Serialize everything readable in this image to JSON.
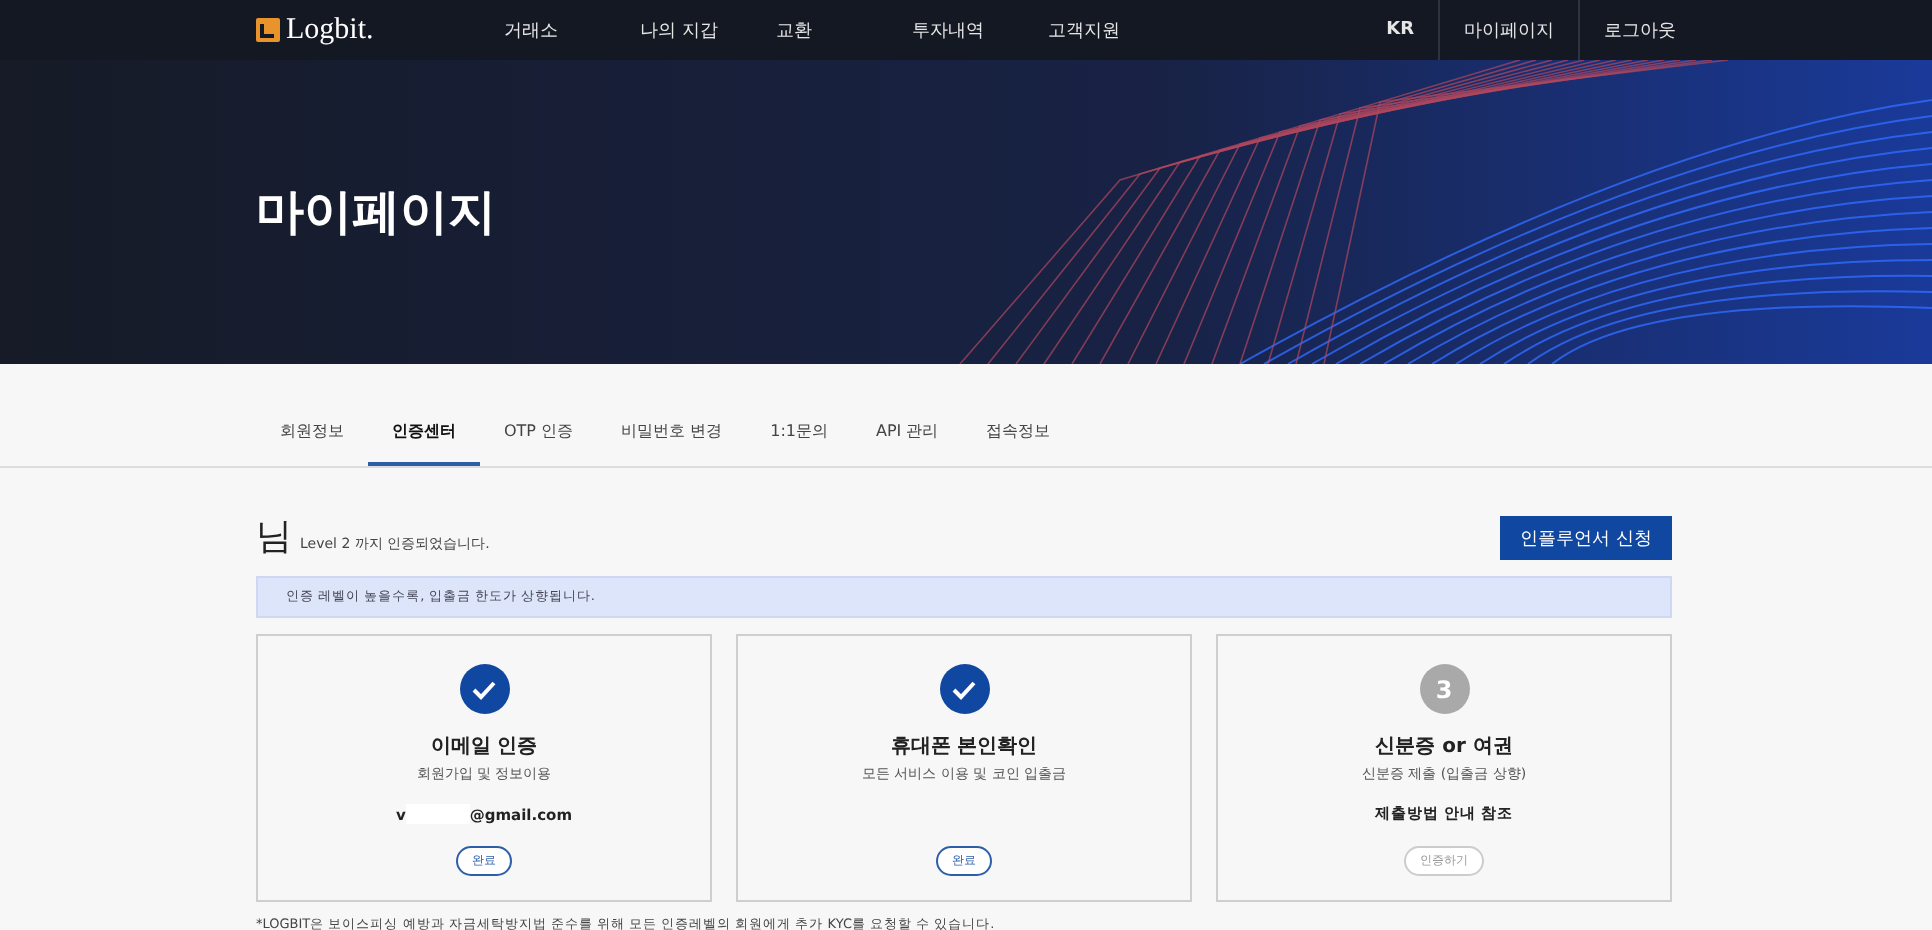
{
  "nav": {
    "logo": "Logbit.",
    "menu": [
      "거래소",
      "나의 지갑",
      "교환",
      "투자내역",
      "고객지원"
    ],
    "right": [
      "KR",
      "마이페이지",
      "로그아웃"
    ]
  },
  "hero": {
    "title": "마이페이지",
    "kind": "picture"
  },
  "tabs": [
    {
      "label": "회원정보",
      "selected": false
    },
    {
      "label": "인증센터",
      "selected": true
    },
    {
      "label": "OTP 인증",
      "selected": false
    },
    {
      "label": "비밀번호 변경",
      "selected": false
    },
    {
      "label": "1:1문의",
      "selected": false
    },
    {
      "label": "API 관리",
      "selected": false
    },
    {
      "label": "접속정보",
      "selected": false
    }
  ],
  "header": {
    "name": "님",
    "level_text": "Level 2 까지 인증되었습니다.",
    "button": "인플루언서 신청"
  },
  "notice": "인증 레벨이 높을수록, 입출금 한도가 상향됩니다.",
  "steps": [
    {
      "kind": "done",
      "title": "이메일 인증",
      "subtitle": "회원가입 및 정보이용",
      "email_prefix": "v",
      "email_domain": "@gmail.com",
      "button": "완료",
      "disabled": false
    },
    {
      "kind": "done",
      "title": "휴대폰 본인확인",
      "subtitle": "모든 서비스 이용 및 코인 입출금",
      "button": "완료",
      "disabled": false
    },
    {
      "kind": "pending",
      "number": "3",
      "title": "신분증 or 여권",
      "subtitle": "신분증 제출 (입출금 상향)",
      "note": "제출방법 안내 참조",
      "button": "인증하기",
      "disabled": true
    }
  ],
  "footnote": "*LOGBIT은 보이스피싱 예방과 자금세탁방지법 준수를 위해 모든 인증레벨의 회원에게 추가 KYC를 요청할 수 있습니다."
}
